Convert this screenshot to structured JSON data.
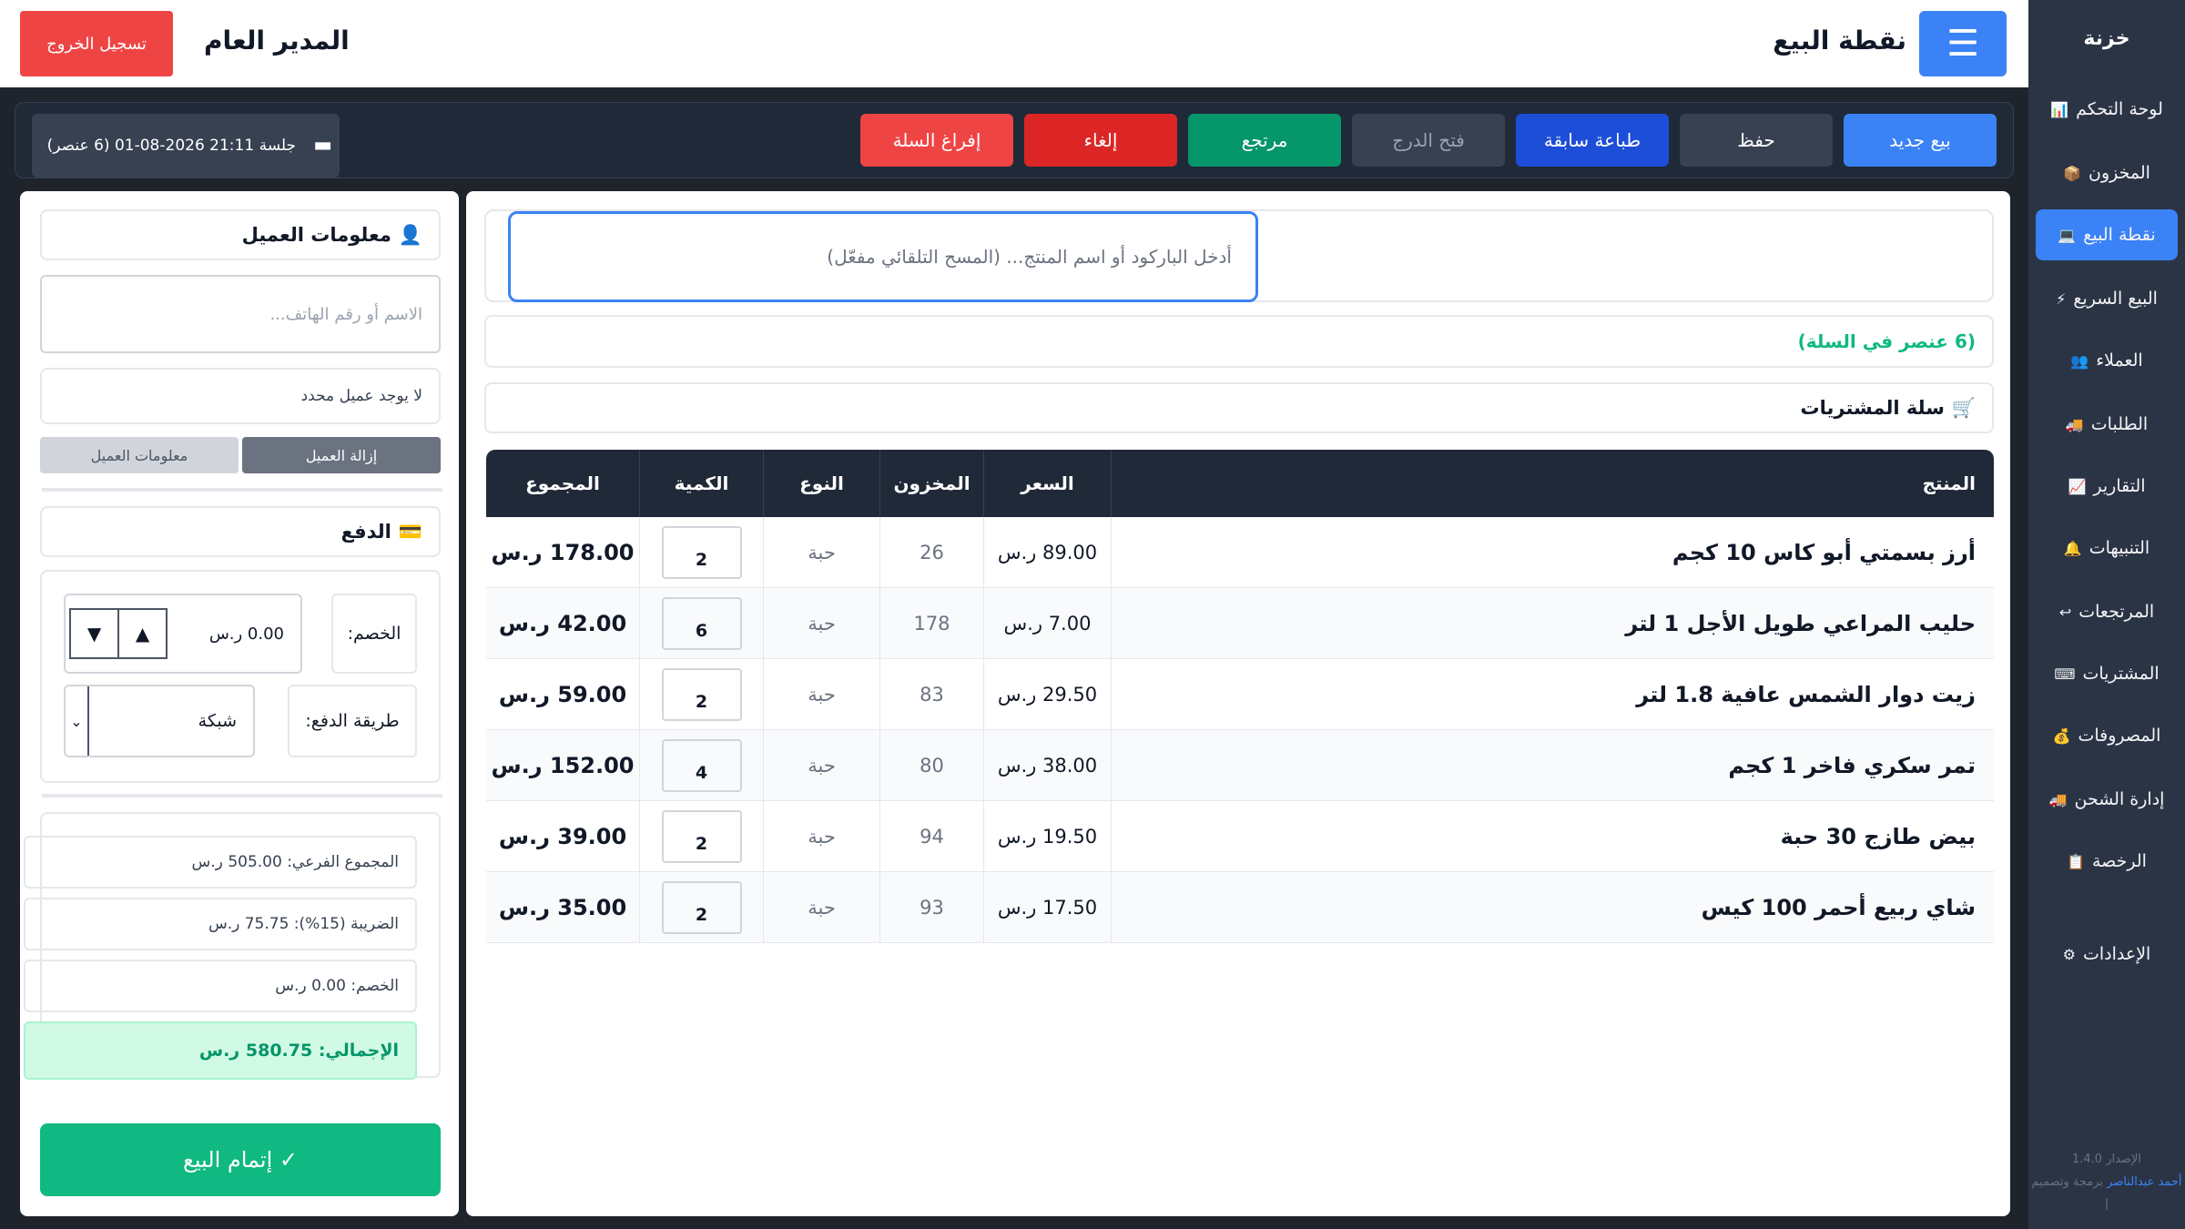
{
  "sidebar": {
    "brand": "خزنة",
    "items": [
      {
        "label": "لوحة التحكم",
        "icon": "📊",
        "icon_name": "chart-icon"
      },
      {
        "label": "المخزون",
        "icon": "📦",
        "icon_name": "box-icon"
      },
      {
        "label": "نقطة البيع",
        "icon": "💻",
        "icon_name": "computer-icon",
        "active": true
      },
      {
        "label": "البيع السريع",
        "icon": "⚡",
        "icon_name": "lightning-icon"
      },
      {
        "label": "العملاء",
        "icon": "👥",
        "icon_name": "users-icon"
      },
      {
        "label": "الطلبات",
        "icon": "🚚",
        "icon_name": "truck-icon"
      },
      {
        "label": "التقارير",
        "icon": "📈",
        "icon_name": "trend-icon"
      },
      {
        "label": "التنبيهات",
        "icon": "🔔",
        "icon_name": "bell-icon"
      },
      {
        "label": "المرتجعات",
        "icon": "↩",
        "icon_name": "return-icon"
      },
      {
        "label": "المشتريات",
        "icon": "⌨",
        "icon_name": "keyboard-icon"
      },
      {
        "label": "المصروفات",
        "icon": "💰",
        "icon_name": "money-bag-icon"
      },
      {
        "label": "إدارة الشحن",
        "icon": "🚚",
        "icon_name": "shipping-truck-icon"
      },
      {
        "label": "الرخصة",
        "icon": "📋",
        "icon_name": "clipboard-icon"
      },
      {
        "label": "الإعدادات",
        "icon": "⚙",
        "icon_name": "gear-icon"
      }
    ],
    "version": "الإصدار 1.4.0",
    "credit": "برمجة وتصميم |",
    "author": "أحمد عبدالناصر"
  },
  "topbar": {
    "menu_icon": "☰",
    "title": "نقطة البيع",
    "user": "المدير العام",
    "logout": "تسجيل الخروج"
  },
  "actions": {
    "new_sale": "بيع جديد",
    "save": "حفظ",
    "print_previous": "طباعة سابقة",
    "open_drawer": "فتح الدرج",
    "return": "مرتجع",
    "cancel": "إلغاء",
    "empty_cart": "إفراغ السلة",
    "session": "جلسة 21:11 2026-08-01 (6 عنصر)"
  },
  "colors": {
    "accent": "#3b82f6",
    "danger": "#ef4444",
    "success": "#10b981",
    "dark": "#1f2937"
  },
  "main": {
    "search_placeholder": "أدخل الباركود أو اسم المنتج... (المسح التلقائي مفعّل)",
    "cart_count": "(6 عنصر في السلة)",
    "cart_title": "سلة المشتريات",
    "cart_icon": "🛒",
    "columns": [
      "المنتج",
      "السعر",
      "المخزون",
      "النوع",
      "الكمية",
      "المجموع"
    ],
    "rows": [
      {
        "name": "أرز بسمتي أبو كاس 10 كجم",
        "price": "89.00 ر.س",
        "stock": "26",
        "type": "حبة",
        "qty": "2",
        "total": "178.00 ر.س"
      },
      {
        "name": "حليب المراعي طويل الأجل 1 لتر",
        "price": "7.00 ر.س",
        "stock": "178",
        "type": "حبة",
        "qty": "6",
        "total": "42.00 ر.س"
      },
      {
        "name": "زيت دوار الشمس عافية 1.8 لتر",
        "price": "29.50 ر.س",
        "stock": "83",
        "type": "حبة",
        "qty": "2",
        "total": "59.00 ر.س"
      },
      {
        "name": "تمر سكري فاخر 1 كجم",
        "price": "38.00 ر.س",
        "stock": "80",
        "type": "حبة",
        "qty": "4",
        "total": "152.00 ر.س"
      },
      {
        "name": "بيض طازج 30 حبة",
        "price": "19.50 ر.س",
        "stock": "94",
        "type": "حبة",
        "qty": "2",
        "total": "39.00 ر.س"
      },
      {
        "name": "شاي ربيع أحمر 100 كيس",
        "price": "17.50 ر.س",
        "stock": "93",
        "type": "حبة",
        "qty": "2",
        "total": "35.00 ر.س"
      }
    ]
  },
  "customer": {
    "title": "معلومات العميل",
    "icon": "👤",
    "search_placeholder": "الاسم أو رقم الهاتف...",
    "no_customer": "لا يوجد عميل محدد",
    "remove": "إزالة العميل",
    "info": "معلومات العميل"
  },
  "payment": {
    "title": "الدفع",
    "icon": "💳",
    "discount_label": "الخصم:",
    "discount_value": "0.00 ر.س",
    "method_label": "طريقة الدفع:",
    "method_value": "شبكة",
    "subtotal": "المجموع الفرعي: 505.00 ر.س",
    "tax": "الضريبة (15%): 75.75 ر.س",
    "discount_line": "الخصم: 0.00 ر.س",
    "grand_total": "الإجمالي: 580.75 ر.س",
    "complete": "✓ إتمام البيع"
  }
}
